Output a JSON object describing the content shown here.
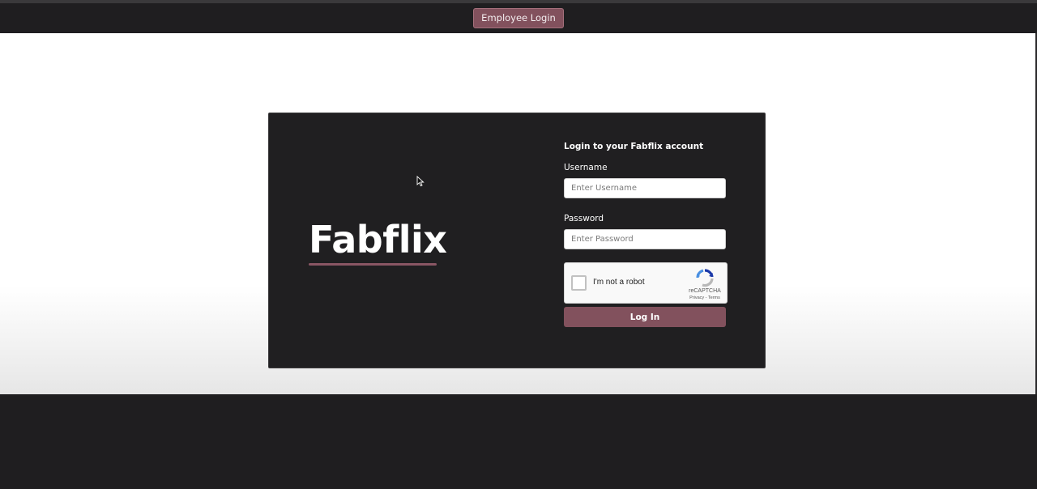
{
  "navbar": {
    "employee_login_label": "Employee Login"
  },
  "brand": {
    "logo_text": "Fabflix"
  },
  "login_form": {
    "title": "Login to your Fabflix account",
    "username_label": "Username",
    "username_placeholder": "Enter Username",
    "username_value": "",
    "password_label": "Password",
    "password_placeholder": "Enter Password",
    "password_value": "",
    "submit_label": "Log In"
  },
  "recaptcha": {
    "checkbox_label": "I'm not a robot",
    "brand": "reCAPTCHA",
    "links": "Privacy - Terms",
    "checked": false
  },
  "colors": {
    "accent": "#82515d",
    "background_dark": "#1f1e20",
    "card": "#201f21"
  },
  "icons": {
    "recaptcha_logo": "recaptcha-icon",
    "mouse_cursor": "cursor-arrow-icon"
  }
}
